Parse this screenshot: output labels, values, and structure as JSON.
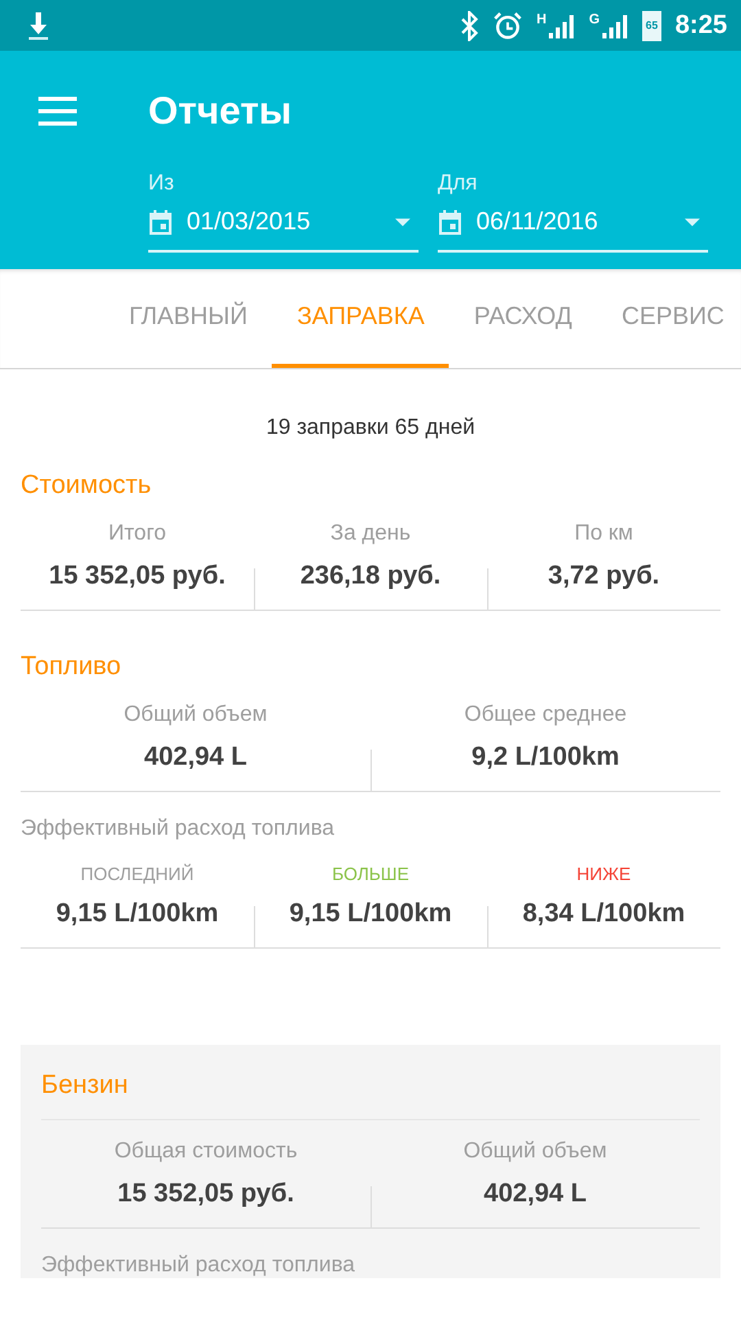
{
  "status_bar": {
    "time": "8:25",
    "battery": "65",
    "networks": [
      "H",
      "G"
    ]
  },
  "app_bar": {
    "title": "Отчеты",
    "from": {
      "label": "Из",
      "value": "01/03/2015"
    },
    "to": {
      "label": "Для",
      "value": "06/11/2016"
    }
  },
  "tabs": [
    {
      "label": "ГЛАВНЫЙ",
      "selected": false
    },
    {
      "label": "ЗАПРАВКА",
      "selected": true
    },
    {
      "label": "РАСХОД",
      "selected": false
    },
    {
      "label": "СЕРВИС",
      "selected": false
    }
  ],
  "summary": "19 заправки 65 дней",
  "sections": [
    {
      "kind": "plain",
      "title": "Стоимость",
      "blocks": [
        {
          "kind": "stats",
          "items": [
            {
              "label": "Итого",
              "value": "15 352,05 руб."
            },
            {
              "label": "За день",
              "value": "236,18 руб."
            },
            {
              "label": "По км",
              "value": "3,72 руб."
            }
          ]
        }
      ]
    },
    {
      "kind": "plain",
      "title": "Топливо",
      "blocks": [
        {
          "kind": "stats",
          "items": [
            {
              "label": "Общий объем",
              "value": "402,94 L"
            },
            {
              "label": "Общее среднее",
              "value": "9,2 L/100km"
            }
          ]
        },
        {
          "kind": "caption",
          "text": "Эффективный расход топлива"
        },
        {
          "kind": "compare",
          "items": [
            {
              "label": "ПОСЛЕДНИЙ",
              "value": "9,15 L/100km",
              "color": "#9e9e9e"
            },
            {
              "label": "БОЛЬШЕ",
              "value": "9,15 L/100km",
              "color": "#8bc34a"
            },
            {
              "label": "НИЖЕ",
              "value": "8,34 L/100km",
              "color": "#f44336"
            }
          ]
        }
      ]
    },
    {
      "kind": "card",
      "title": "Бензин",
      "blocks": [
        {
          "kind": "stats",
          "items": [
            {
              "label": "Общая стоимость",
              "value": "15 352,05 руб."
            },
            {
              "label": "Общий объем",
              "value": "402,94 L"
            }
          ]
        },
        {
          "kind": "caption",
          "text": "Эффективный расход топлива"
        }
      ]
    }
  ]
}
